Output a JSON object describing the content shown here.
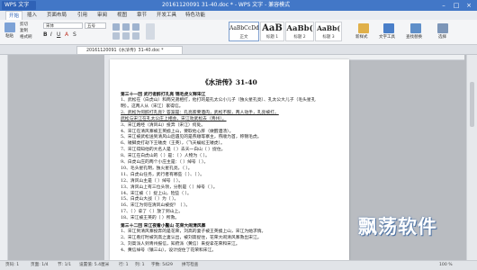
{
  "titlebar": {
    "app_button": "WPS 文字",
    "title": "20161120091 31-40.doc * - WPS 文字 - 兼容模式",
    "min": "–",
    "max": "□",
    "close": "×"
  },
  "menu": [
    "开始",
    "插入",
    "页面布局",
    "引用",
    "审阅",
    "视图",
    "章节",
    "开发工具",
    "特色功能"
  ],
  "ribbon": {
    "paste": "粘贴",
    "cut": "剪切",
    "copy": "复制",
    "format_painter": "格式刷",
    "font_name": "宋体",
    "font_size": "五号",
    "styles": [
      {
        "sample": "AaBbCcDd",
        "name": "正文"
      },
      {
        "sample": "AaB",
        "name": "标题 1"
      },
      {
        "sample": "AaBb(",
        "name": "标题 2"
      },
      {
        "sample": "AaBb(",
        "name": "标题 3"
      }
    ],
    "new_style": "新样式",
    "text_tools": "文字工具",
    "find_replace": "查找替换",
    "select": "选择"
  },
  "tab": {
    "label": "20161120091《水浒传》31-40.doc *"
  },
  "document": {
    "title": "《水浒传》31-40",
    "lines": [
      {
        "t": "第三十一回   武行者醉打孔亮   锦毛虎义释宋江",
        "s": "h"
      },
      {
        "t": "1、武松在（白虎山）和两兄弟相打，他打的是孔太公小儿子（独火星孔亮）、孔太公大儿子（毛头星孔",
        "s": ""
      },
      {
        "t": "明）。这两人从（宋江）家得信。",
        "s": ""
      },
      {
        "t": "2、武松为何醉打孔亮？答案是：孔亮索要酒肉，武松不服，两人动手，孔亮被打。",
        "s": "u"
      },
      {
        "t": "武松与宋江在孔太公庄上相会，宋江劝武松去（青州）。",
        "s": "u"
      },
      {
        "t": "3、宋江路经（清风山）投奔（宋江）何处。",
        "s": ""
      },
      {
        "t": "4、宋江在清风寨被王英掳上山，要取他心肝（做醒酒汤）。",
        "s": ""
      },
      {
        "t": "5、宋江被武松送到清风山后遇见的是燕顺等寨主，燕顺为首，称锦毛虎。",
        "s": ""
      },
      {
        "t": "6、矮脚虎打劫下王矮虎（王英），（飞天蜈蚣王矮虎）。",
        "s": ""
      },
      {
        "t": "7、宋江得知他的大名人是（    ）去天一白山（    ）捉住。",
        "s": ""
      },
      {
        "t": "8、宋江在白虎山的（   ）是：（    ）人物为（    ）。",
        "s": ""
      },
      {
        "t": "9、白虎山庄的两个小庄主是：（     ）绰号（     ）。",
        "s": ""
      },
      {
        "t": "10、毛头星孔明，独火星孔亮，（    ）。",
        "s": ""
      },
      {
        "t": "11、白虎山任务，武行者有哪些（     ）、（     ）。",
        "s": ""
      },
      {
        "t": "12、清风山主是（    ）绰号（    ）。",
        "s": ""
      },
      {
        "t": "13、清风山上有三位头领，分别是（    ）绰号（    ）。",
        "s": ""
      },
      {
        "t": "14、宋江被（   ）捉上山，险些（    ）。",
        "s": ""
      },
      {
        "t": "15、白虎山大战（  ）为（  ）。",
        "s": ""
      },
      {
        "t": "16、宋江为何在清风山被捉？（     ）。",
        "s": ""
      },
      {
        "t": "17、（     ）拿了（    ）放了到山上。",
        "s": ""
      },
      {
        "t": "18、宋江被王英的（     ）所救。",
        "s": ""
      },
      {
        "t": "第三十二回   宋江夜看小鳌山   花荣大闹清风寨",
        "s": "h"
      },
      {
        "t": "1、宋江到清风寨投奔的是花荣，刘高的妻子被王英掳上山，宋江为她求情。",
        "s": ""
      },
      {
        "t": "2、宋江看灯时被刘高之妻认出，被刘高捉住，花荣大闹清风寨救出宋江。",
        "s": ""
      },
      {
        "t": "3、刘高派人到青州报信，知府派（黄信）来捉拿花荣和宋江。",
        "s": ""
      },
      {
        "t": "4、黄信绰号（镇三山），设计捉住了花荣和宋江。",
        "s": ""
      }
    ]
  },
  "status": {
    "page": "页码: 1",
    "pages": "页面: 1/4",
    "section": "节: 1/1",
    "settings": "设置值: 5.4厘米",
    "row": "行: 1",
    "col": "列: 1",
    "words": "字数: 5429",
    "spell": "拼写检查",
    "zoom": "100 %"
  },
  "watermark": "飘荡软件",
  "colors": {
    "accent": "#4277c7",
    "page": "#ffffff",
    "workspace": "#b9bcc1"
  }
}
